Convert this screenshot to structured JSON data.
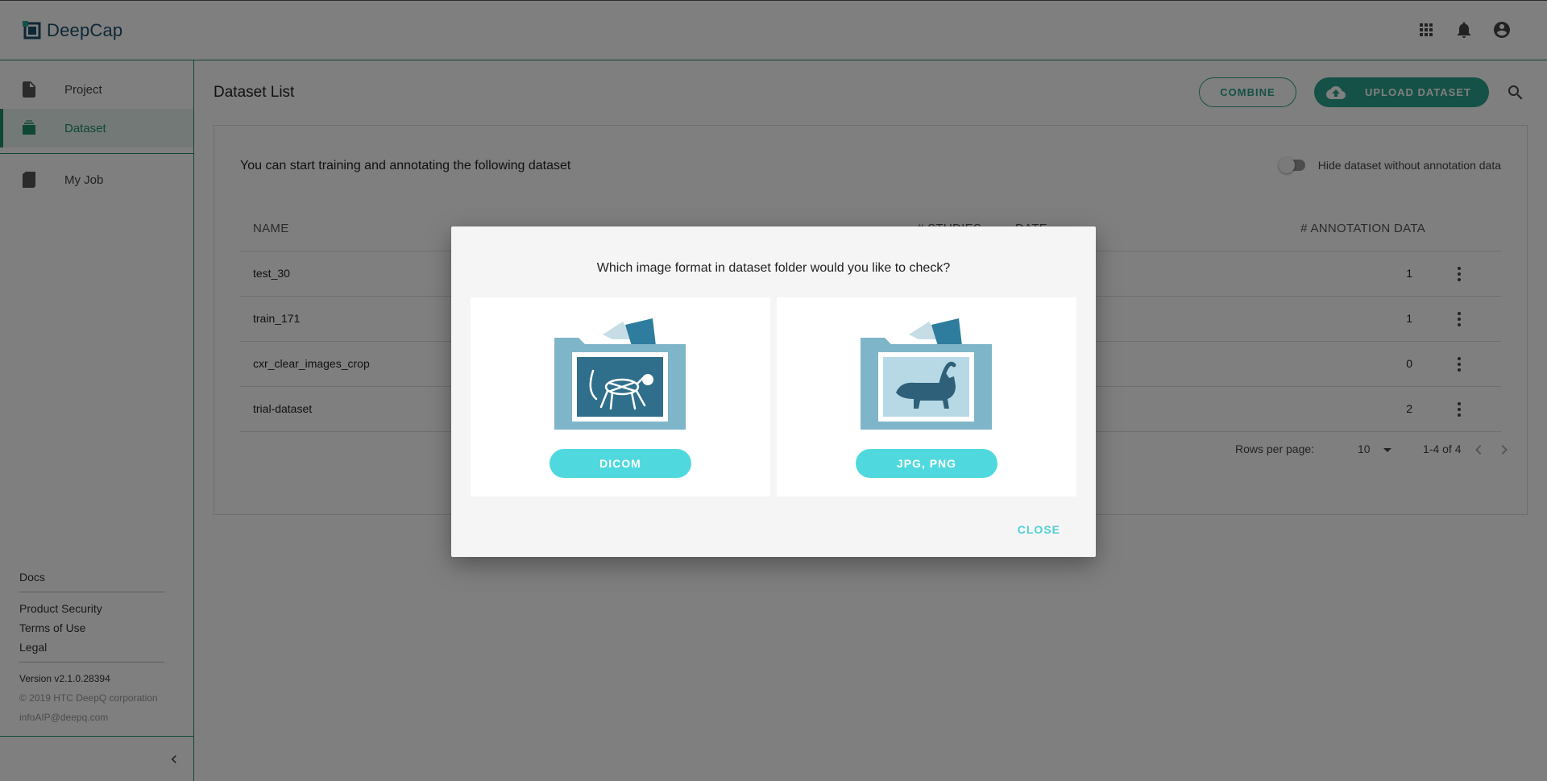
{
  "header": {
    "brand_name": "DeepCap",
    "icons": [
      "apps-grid-icon",
      "bell-icon",
      "account-circle-icon"
    ]
  },
  "sidebar": {
    "items": [
      {
        "label": "Project",
        "icon": "file-icon",
        "active": false
      },
      {
        "label": "Dataset",
        "icon": "folder-stack-icon",
        "active": true
      },
      {
        "label": "My Job",
        "icon": "book-icon",
        "active": false
      }
    ],
    "footer": {
      "docs": "Docs",
      "product_security": "Product Security",
      "terms": "Terms of Use",
      "legal": "Legal",
      "version": "Version v2.1.0.28394",
      "copyright": "© 2019 HTC DeepQ corporation",
      "email": "infoAIP@deepq.com"
    }
  },
  "main": {
    "title": "Dataset List",
    "combine_label": "COMBINE",
    "upload_label": "UPLOAD DATASET",
    "subtitle": "You can start training and annotating the following dataset",
    "toggle_label": "Hide dataset without annotation data",
    "toggle_on": false,
    "table": {
      "headers": {
        "name": "NAME",
        "studies": "# STUDIES",
        "date": "DATE",
        "annotation": "# ANNOTATION DATA"
      },
      "rows": [
        {
          "name": "test_30",
          "annotation": "1"
        },
        {
          "name": "train_171",
          "annotation": "1"
        },
        {
          "name": "cxr_clear_images_crop",
          "annotation": "0"
        },
        {
          "name": "trial-dataset",
          "annotation": "2"
        }
      ]
    },
    "pagination": {
      "rows_per_page_label": "Rows per page:",
      "rows_per_page": "10",
      "range": "1-4 of 4"
    }
  },
  "dialog": {
    "title": "Which image format in dataset folder would you like to check?",
    "options": [
      {
        "label": "DICOM",
        "icon": "xray-cat-folder-icon"
      },
      {
        "label": "JPG, PNG",
        "icon": "cat-photo-folder-icon"
      }
    ],
    "close_label": "CLOSE"
  },
  "colors": {
    "accent": "#2aa38c",
    "brand": "#1c4f6b",
    "dialog_button": "#4fd9df"
  }
}
